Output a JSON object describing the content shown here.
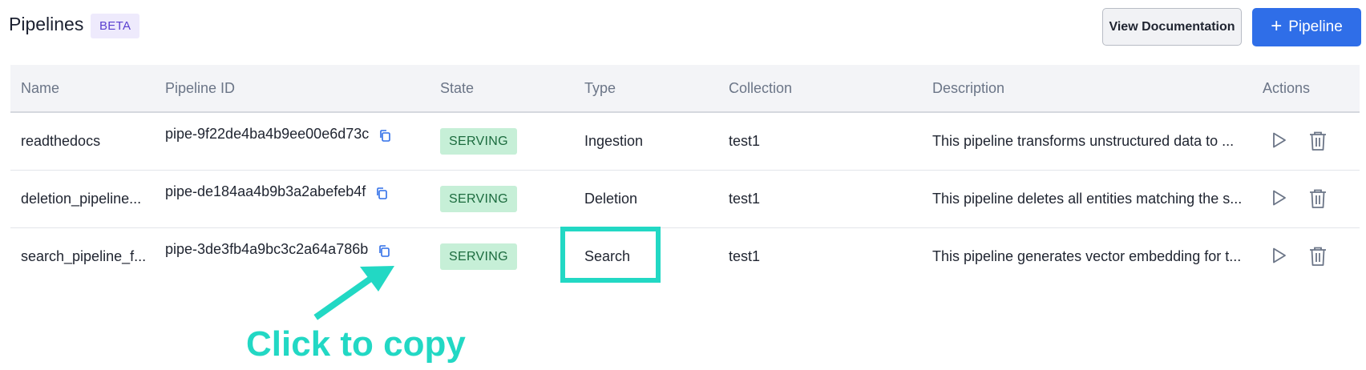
{
  "header": {
    "title": "Pipelines",
    "badge": "BETA",
    "docs_button": "View Documentation",
    "add_button": "Pipeline"
  },
  "table": {
    "columns": [
      "Name",
      "Pipeline ID",
      "State",
      "Type",
      "Collection",
      "Description",
      "Actions"
    ],
    "rows": [
      {
        "name": "readthedocs",
        "pipeline_id": "pipe-9f22de4ba4b9ee00e6d73c",
        "state": "SERVING",
        "type": "Ingestion",
        "collection": "test1",
        "description": "This pipeline transforms unstructured data to ..."
      },
      {
        "name": "deletion_pipeline...",
        "pipeline_id": "pipe-de184aa4b9b3a2abefeb4f",
        "state": "SERVING",
        "type": "Deletion",
        "collection": "test1",
        "description": "This pipeline deletes all entities matching the s..."
      },
      {
        "name": "search_pipeline_f...",
        "pipeline_id": "pipe-3de3fb4a9bc3c2a64a786b",
        "state": "SERVING",
        "type": "Search",
        "collection": "test1",
        "description": "This pipeline generates vector embedding for t..."
      }
    ]
  },
  "annotation": {
    "text": "Click to copy",
    "color": "#22d8c4"
  },
  "colors": {
    "primary": "#2f6ee8",
    "beta_bg": "#eeeafc",
    "serving_bg": "#c6efd7",
    "annotation": "#22d8c4"
  },
  "icons": {
    "copy": "copy-icon",
    "run": "play-icon",
    "delete": "trash-icon"
  }
}
